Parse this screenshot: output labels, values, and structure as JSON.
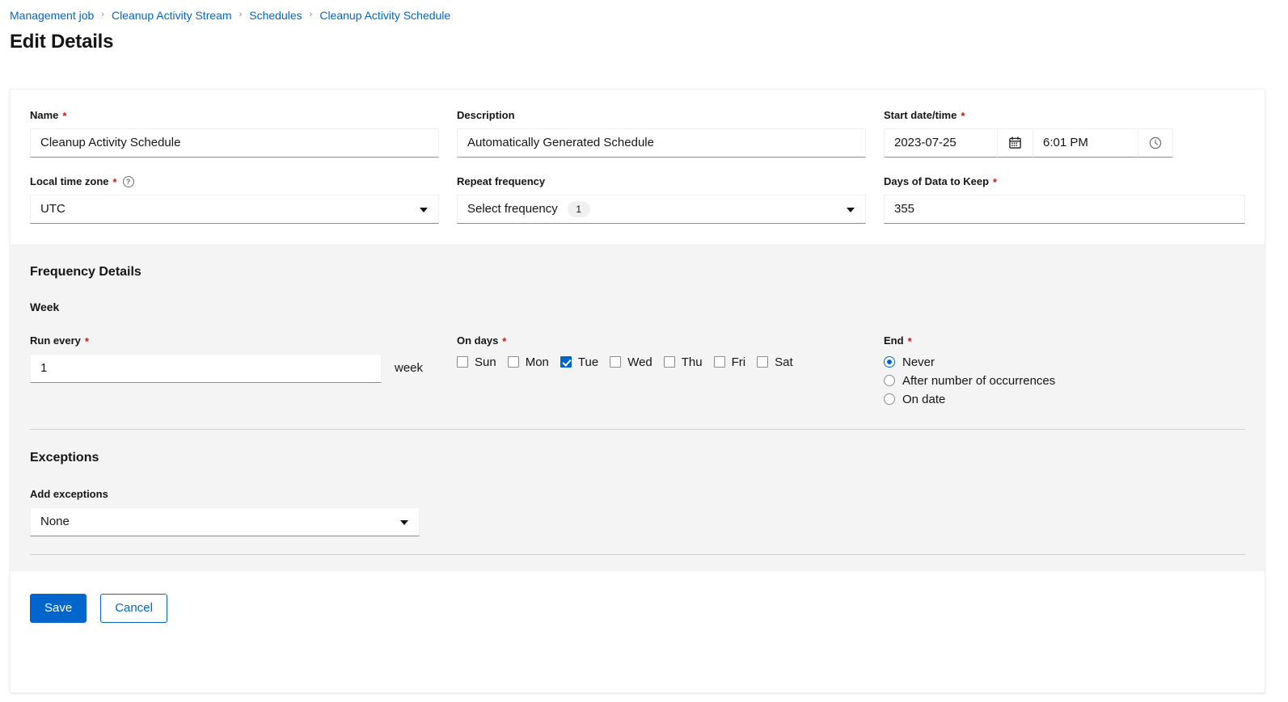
{
  "header": {
    "breadcrumb": [
      {
        "label": "Management job"
      },
      {
        "label": "Cleanup Activity Stream"
      },
      {
        "label": "Schedules"
      },
      {
        "label": "Cleanup Activity Schedule"
      }
    ],
    "separator": "›",
    "title": "Edit Details"
  },
  "form": {
    "name": {
      "label": "Name",
      "required": "*",
      "value": "Cleanup Activity Schedule"
    },
    "description": {
      "label": "Description",
      "value": "Automatically Generated Schedule"
    },
    "start_datetime": {
      "label": "Start date/time",
      "required": "*",
      "date": "2023-07-25",
      "time": "6:01 PM",
      "calendar_icon": "calendar-icon",
      "clock_icon": "clock-icon"
    },
    "local_time_zone": {
      "label": "Local time zone",
      "required": "*",
      "help_icon": "?",
      "value": "UTC"
    },
    "repeat_frequency": {
      "label": "Repeat frequency",
      "value": "Select frequency",
      "badge": "1"
    },
    "days_to_keep": {
      "label": "Days of Data to Keep",
      "required": "*",
      "value": "355"
    }
  },
  "frequency_details": {
    "section_title": "Frequency Details",
    "sub_title": "Week",
    "run_every": {
      "label": "Run every",
      "required": "*",
      "value": "1",
      "unit": "week"
    },
    "on_days": {
      "label": "On days",
      "required": "*",
      "days": [
        {
          "label": "Sun",
          "checked": false
        },
        {
          "label": "Mon",
          "checked": false
        },
        {
          "label": "Tue",
          "checked": true
        },
        {
          "label": "Wed",
          "checked": false
        },
        {
          "label": "Thu",
          "checked": false
        },
        {
          "label": "Fri",
          "checked": false
        },
        {
          "label": "Sat",
          "checked": false
        }
      ]
    },
    "end": {
      "label": "End",
      "required": "*",
      "options": [
        {
          "label": "Never",
          "selected": true
        },
        {
          "label": "After number of occurrences",
          "selected": false
        },
        {
          "label": "On date",
          "selected": false
        }
      ]
    }
  },
  "exceptions": {
    "section_title": "Exceptions",
    "add_exceptions": {
      "label": "Add exceptions",
      "value": "None"
    }
  },
  "footer": {
    "save_label": "Save",
    "cancel_label": "Cancel"
  },
  "colors": {
    "accent": "#0066CC",
    "required": "#C9190B",
    "panel_gray": "#F4F4F4"
  }
}
